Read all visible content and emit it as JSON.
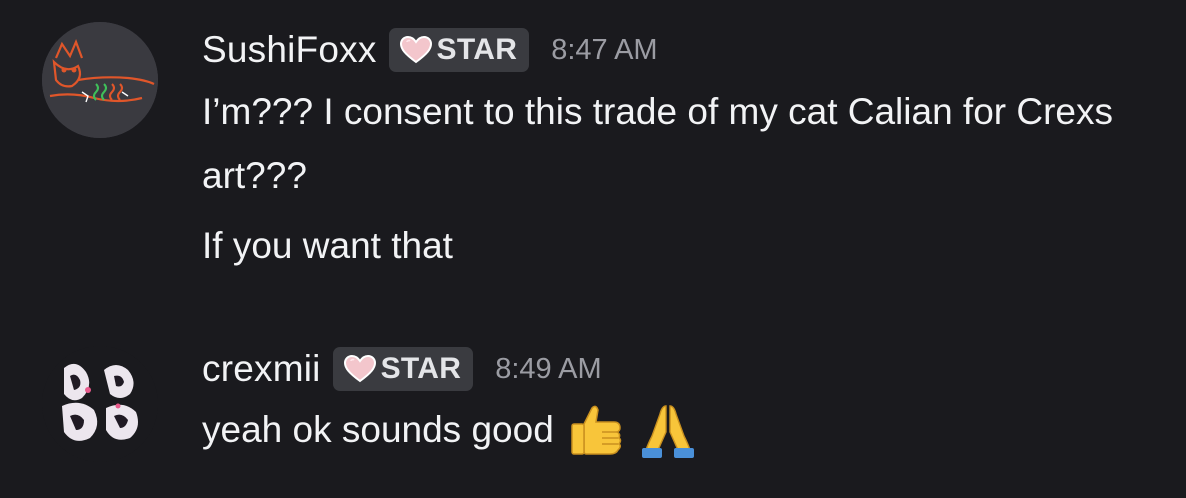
{
  "messages": [
    {
      "username": "SushiFoxx",
      "badge": "STAR",
      "timestamp": "8:47 AM",
      "lines": [
        "I’m??? I consent to this trade of my cat Calian for Crexs art???",
        "If you want that"
      ]
    },
    {
      "username": "crexmii",
      "badge": "STAR",
      "timestamp": "8:49 AM",
      "lines": [
        "yeah ok sounds good"
      ],
      "emojis": [
        "thumbs-up-emoji",
        "folded-hands-emoji"
      ]
    }
  ],
  "colors": {
    "background": "#1a1a1e",
    "text": "#f2f3f5",
    "timestamp": "#9b9ca3",
    "badge_bg": "#3a3b40",
    "badge_heart": "#f3c6cc"
  }
}
